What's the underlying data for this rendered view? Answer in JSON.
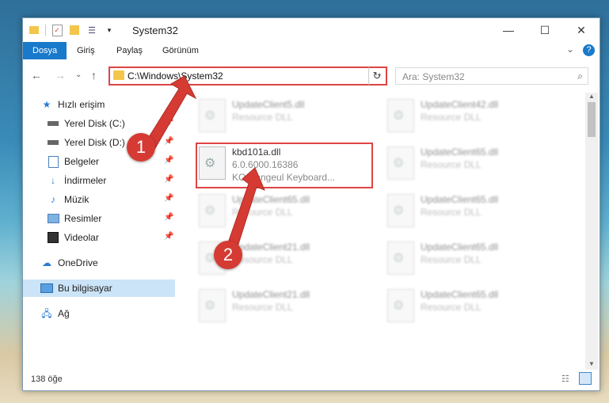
{
  "window": {
    "title": "System32"
  },
  "quick_access_toolbar": {
    "icons": [
      "folder-icon",
      "properties-icon",
      "new-folder-icon",
      "customize-icon",
      "dropdown-icon"
    ]
  },
  "window_controls": {
    "minimize": "—",
    "maximize": "☐",
    "close": "✕"
  },
  "ribbon": {
    "tabs": [
      "Dosya",
      "Giriş",
      "Paylaş",
      "Görünüm"
    ],
    "expand": "⌄",
    "help": "?"
  },
  "nav": {
    "back": "←",
    "forward": "→",
    "recent": "⌄",
    "up": "↑"
  },
  "address": {
    "path": "C:\\Windows\\System32",
    "dropdown": "⌄",
    "refresh": "↻"
  },
  "search": {
    "placeholder": "Ara: System32",
    "icon": "⌕"
  },
  "navpane": {
    "quick_access": "Hızlı erişim",
    "items": [
      "Yerel Disk (C:)",
      "Yerel Disk (D:)",
      "Belgeler",
      "İndirmeler",
      "Müzik",
      "Resimler",
      "Videolar"
    ],
    "onedrive": "OneDrive",
    "this_pc": "Bu bilgisayar",
    "network": "Ağ"
  },
  "files": {
    "left": [
      {
        "name": "UpdateClient5.dll",
        "sub": "Resource DLL"
      },
      {
        "name": "kbd101a.dll",
        "sub": "6.0.6000.16386",
        "desc": "KO Hangeul Keyboard..."
      },
      {
        "name": "UpdateClient65.dll",
        "sub": "Resource DLL"
      },
      {
        "name": "UpdateClient21.dll",
        "sub": "Resource DLL"
      },
      {
        "name": "UpdateClient21.dll",
        "sub": "Resource DLL"
      }
    ],
    "right": [
      {
        "name": "UpdateClient42.dll",
        "sub": "Resource DLL"
      },
      {
        "name": "UpdateClient65.dll",
        "sub": "Resource DLL"
      },
      {
        "name": "UpdateClient65.dll",
        "sub": "Resource DLL"
      },
      {
        "name": "UpdateClient65.dll",
        "sub": "Resource DLL"
      },
      {
        "name": "UpdateClient65.dll",
        "sub": "Resource DLL"
      }
    ]
  },
  "status": {
    "count": "138 öğe"
  },
  "badges": [
    "1",
    "2"
  ],
  "colors": {
    "accent": "#1979ca",
    "highlight": "#d44444",
    "badge": "#d53b33"
  }
}
